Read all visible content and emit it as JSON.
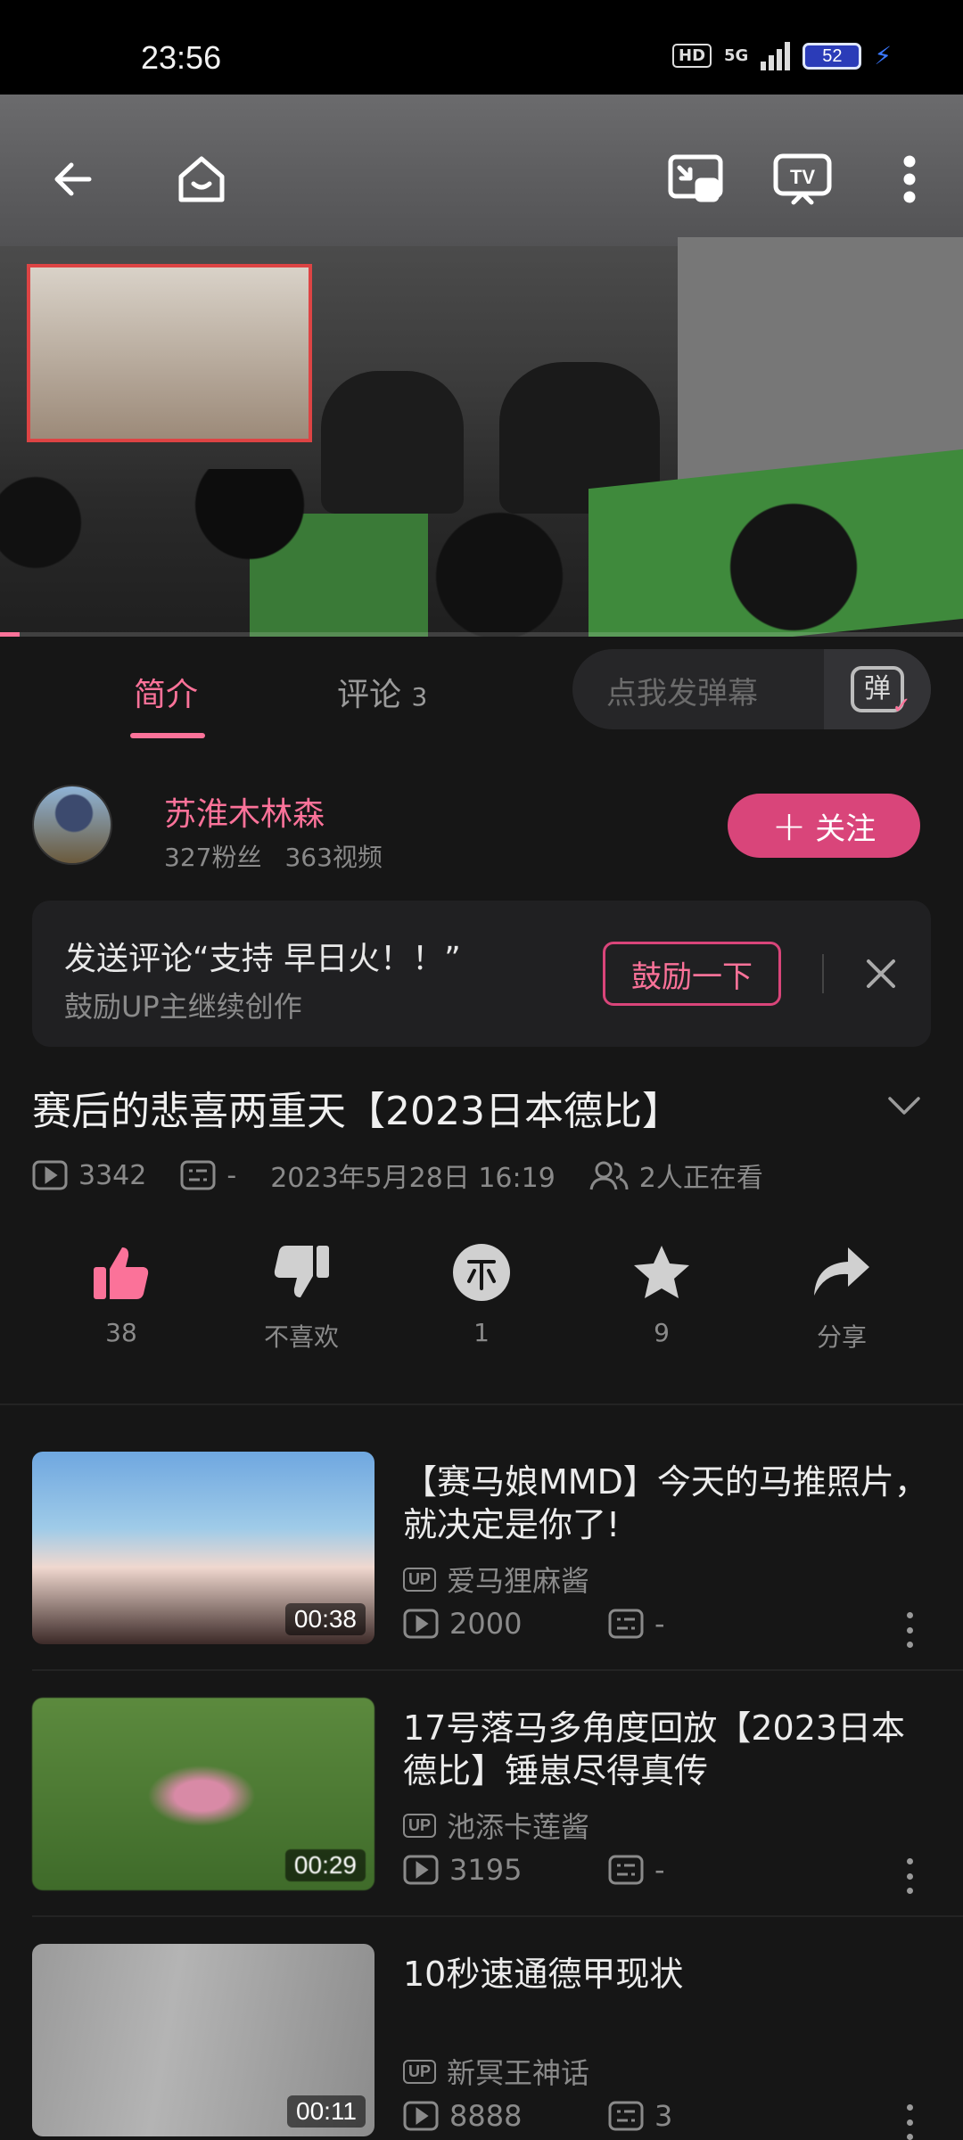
{
  "status_bar": {
    "time": "23:56",
    "network_badge": "HD",
    "network_type": "5G",
    "battery": "52"
  },
  "player": {
    "icons": [
      "back-arrow-icon",
      "home-icon",
      "picture-in-picture-icon",
      "tv-cast-icon",
      "more-vertical-icon"
    ],
    "cast_label": "TV",
    "progress_fraction": 0.02
  },
  "tabs": {
    "intro_label": "简介",
    "comments_label": "评论",
    "comments_count": "3",
    "danmaku_placeholder": "点我发弹幕",
    "danmaku_icon_label": "弹"
  },
  "uploader": {
    "name": "苏淮木林森",
    "fans": "327粉丝",
    "videos": "363视频",
    "follow_label": "关注"
  },
  "prompt_card": {
    "title": "发送评论“支持 早日火！！”",
    "subtitle": "鼓励UP主继续创作",
    "button_label": "鼓励一下"
  },
  "video": {
    "title": "赛后的悲喜两重天【2023日本德比】",
    "views": "3342",
    "danmaku_count": "-",
    "date": "2023年5月28日 16:19",
    "watching": "2人正在看"
  },
  "actions": [
    {
      "icon": "thumbs-up-icon",
      "label": "38"
    },
    {
      "icon": "thumbs-down-icon",
      "label": "不喜欢"
    },
    {
      "icon": "coin-icon",
      "label": "1"
    },
    {
      "icon": "star-icon",
      "label": "9"
    },
    {
      "icon": "share-icon",
      "label": "分享"
    }
  ],
  "recommendations": [
    {
      "title": "【赛马娘MMD】今天的马推照片，就决定是你了!",
      "uploader": "爱马狸麻酱",
      "views": "2000",
      "danmaku": "-",
      "duration": "00:38"
    },
    {
      "title": "17号落马多角度回放【2023日本德比】锤崽尽得真传",
      "uploader": "池添卡莲酱",
      "views": "3195",
      "danmaku": "-",
      "duration": "00:29"
    },
    {
      "title": "10秒速通德甲现状",
      "uploader": "新冥王神话",
      "views": "8888",
      "danmaku": "3",
      "duration": "00:11"
    }
  ],
  "colors": {
    "accent": "#fb7299",
    "follow_bg": "#d9457a",
    "like_active": "#fb7299",
    "background": "#161616"
  }
}
